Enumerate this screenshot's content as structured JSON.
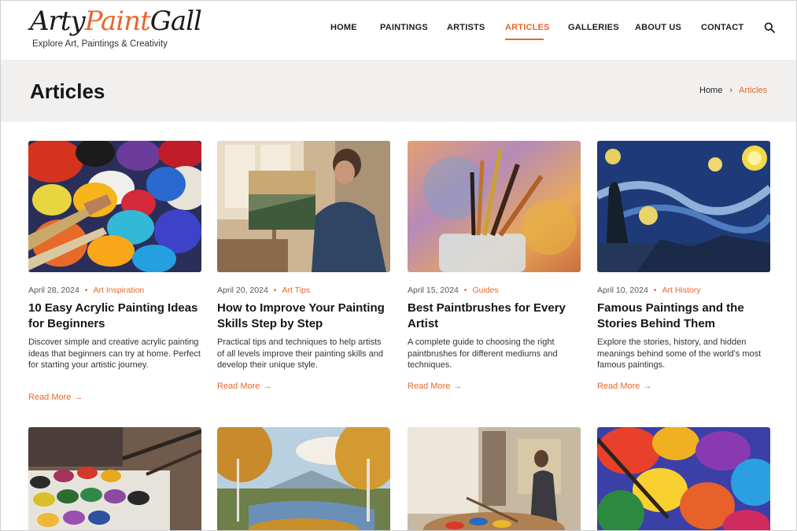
{
  "header": {
    "logo_part1": "Arty",
    "logo_part2": "Paint",
    "logo_part3": "Gall",
    "tagline": "Explore Art, Paintings & Creativity",
    "nav": [
      "HOME",
      "PAINTINGS",
      "ARTISTS",
      "ARTICLES",
      "GALLERIES",
      "ABOUT US",
      "CONTACT"
    ],
    "active_nav": "ARTICLES",
    "search_icon": "search-icon"
  },
  "banner": {
    "title": "Articles",
    "breadcrumb_home": "Home",
    "breadcrumb_sep": "›",
    "breadcrumb_current": "Articles"
  },
  "articles": [
    {
      "date": "April 28, 2024",
      "category": "Art Inspiration",
      "title": "10 Easy Acrylic Painting Ideas for Beginners",
      "excerpt": "Discover simple and creative acrylic painting ideas that beginners can try at home. Perfect for starting your artistic journey.",
      "read_more": "Read More"
    },
    {
      "date": "April 20, 2024",
      "category": "Art Tips",
      "title": "How to Improve Your Painting Skills Step by Step",
      "excerpt": "Practical tips and techniques to help artists of all levels improve their painting skills and develop their unique style.",
      "read_more": "Read More"
    },
    {
      "date": "April 15, 2024",
      "category": "Guides",
      "title": "Best Paintbrushes for Every Artist",
      "excerpt": "A complete guide to choosing the right paintbrushes for different mediums and techniques.",
      "read_more": "Read More"
    },
    {
      "date": "April 10, 2024",
      "category": "Art History",
      "title": "Famous Paintings and the Stories Behind Them",
      "excerpt": "Explore the stories, history, and hidden meanings behind some of the world's most famous paintings.",
      "read_more": "Read More"
    }
  ],
  "colors": {
    "accent": "#e8672b",
    "text": "#151515",
    "banner_bg": "#f1f0ef"
  }
}
